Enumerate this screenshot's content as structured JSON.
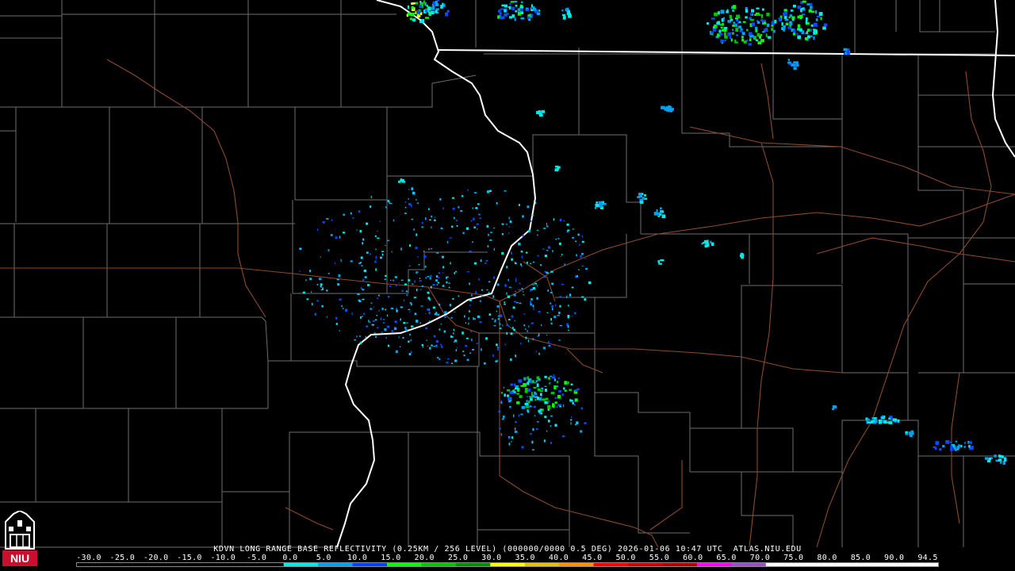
{
  "caption": {
    "station": "KDVN",
    "product": "LONG RANGE BASE REFLECTIVITY",
    "resolution": "(0.25KM / 256 LEVEL)",
    "elevation": "(000000/0000 0.5 DEG)",
    "date": "2026-01-06",
    "time": "10:47 UTC",
    "site": "ATLAS.NIU.EDU"
  },
  "scale": {
    "labels": [
      "-30.0",
      "-25.0",
      "-20.0",
      "-15.0",
      "-10.0",
      "-5.0",
      "0.0",
      "5.0",
      "10.0",
      "15.0",
      "20.0",
      "25.0",
      "30.0",
      "35.0",
      "40.0",
      "45.0",
      "50.0",
      "55.0",
      "60.0",
      "65.0",
      "70.0",
      "75.0",
      "80.0",
      "85.0",
      "90.0",
      "94.5"
    ],
    "colors": [
      "#000000",
      "#000000",
      "#000000",
      "#000000",
      "#000000",
      "#000000",
      "#00eaea",
      "#00a0f0",
      "#0040ff",
      "#00ff00",
      "#00c800",
      "#009000",
      "#ffff00",
      "#e8c000",
      "#ff9000",
      "#ff0000",
      "#d00000",
      "#b00000",
      "#ff00ff",
      "#9850c8",
      "#ffffff",
      "#ffffff",
      "#ffffff",
      "#ffffff",
      "#ffffff"
    ]
  },
  "logo": {
    "text": "NIU",
    "color": "#c8102e"
  },
  "colors": {
    "background": "#000000",
    "county_lines": "#6e6e6e",
    "state_lines": "#ffffff",
    "highways": "#8b4a2b"
  }
}
